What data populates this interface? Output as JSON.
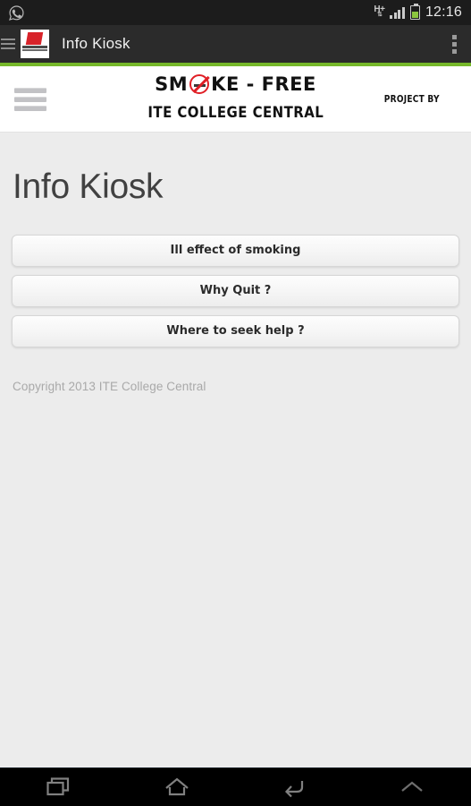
{
  "status_bar": {
    "notification_icon": "whatsapp-icon",
    "network_type": "H+",
    "network_arrows": "⇅",
    "signal_icon": "signal-bars-icon",
    "battery_icon": "battery-icon",
    "time": "12:16"
  },
  "action_bar": {
    "drawer_icon": "hamburger-icon",
    "app_icon": "smoke-free-app-icon",
    "title": "Info Kiosk",
    "overflow_icon": "overflow-menu-icon"
  },
  "site_header": {
    "menu_icon": "hamburger-menu-icon",
    "brand": {
      "word_start": "SM",
      "nosmoking_icon": "no-smoking-icon",
      "word_end": "KE - FREE",
      "project_by": "PROJECT BY",
      "organization": "ITE COLLEGE CENTRAL"
    },
    "accent_color": "#76b82a"
  },
  "main": {
    "page_title": "Info Kiosk",
    "buttons": [
      {
        "label": "Ill effect of smoking"
      },
      {
        "label": "Why Quit ?"
      },
      {
        "label": "Where to seek help ?"
      }
    ],
    "copyright": "Copyright 2013 ITE College Central"
  },
  "nav_bar": {
    "items": [
      {
        "name": "recents-icon"
      },
      {
        "name": "home-icon"
      },
      {
        "name": "back-icon"
      },
      {
        "name": "chevron-up-icon"
      }
    ]
  }
}
